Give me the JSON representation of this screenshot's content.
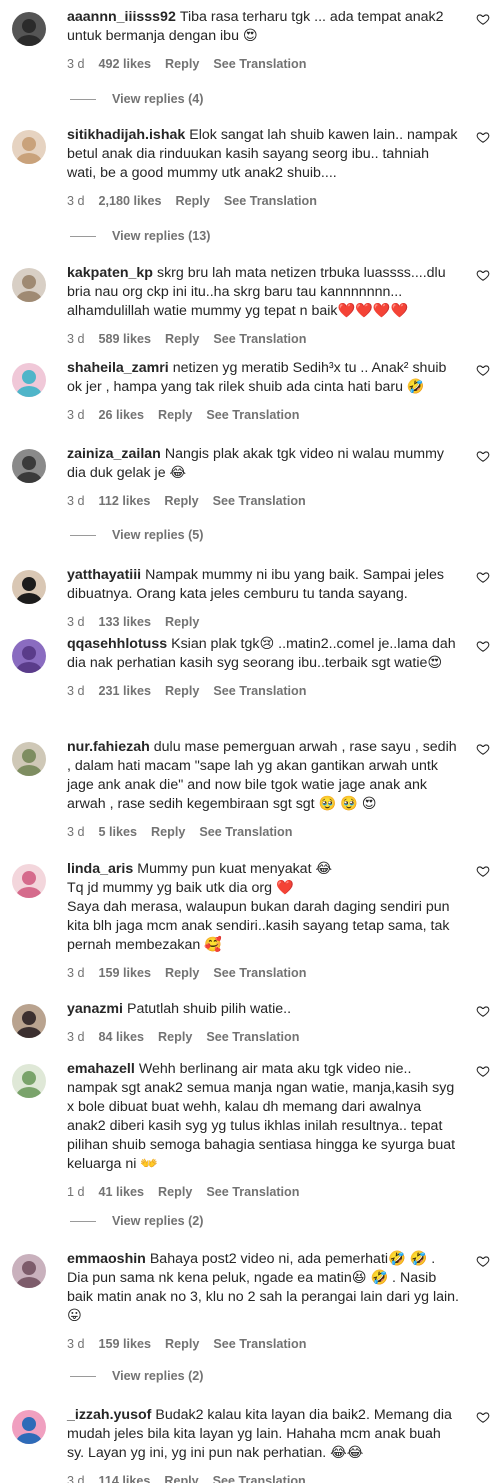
{
  "comments": [
    {
      "username": "aaannn_iiisss92",
      "text": "Tiba rasa terharu tgk ... ada tempat anak2 untuk bermanja dengan ibu 😍",
      "time": "3 d",
      "likes": "492 likes",
      "reply": "Reply",
      "translate": "See Translation",
      "view_replies": "View replies (4)"
    },
    {
      "username": "sitikhadijah.ishak",
      "text": "Elok sangat lah shuib kawen lain.. nampak betul anak dia rinduukan kasih sayang seorg ibu.. tahniah wati, be a good mummy utk anak2 shuib....",
      "time": "3 d",
      "likes": "2,180 likes",
      "reply": "Reply",
      "translate": "See Translation",
      "view_replies": "View replies (13)"
    },
    {
      "username": "kakpaten_kp",
      "text": "skrg bru lah mata netizen trbuka luassss....dlu bria nau org ckp ini itu..ha skrg baru tau kannnnnnn... alhamdulillah watie mummy yg tepat n baik❤️❤️❤️❤️",
      "time": "3 d",
      "likes": "589 likes",
      "reply": "Reply",
      "translate": "See Translation",
      "view_replies": ""
    },
    {
      "username": "shaheila_zamri",
      "text": "netizen yg meratib Sedih³x tu .. Anak² shuib ok jer , hampa yang tak rilek shuib ada cinta hati baru 🤣",
      "time": "3 d",
      "likes": "26 likes",
      "reply": "Reply",
      "translate": "See Translation",
      "view_replies": ""
    },
    {
      "username": "zainiza_zailan",
      "text": "Nangis plak akak tgk video ni walau mummy dia duk gelak je 😂",
      "time": "3 d",
      "likes": "112 likes",
      "reply": "Reply",
      "translate": "See Translation",
      "view_replies": "View replies (5)"
    },
    {
      "username": "yatthayatiii",
      "text": "Nampak mummy ni ibu yang baik. Sampai jeles dibuatnya. Orang kata jeles cemburu tu tanda sayang.",
      "time": "3 d",
      "likes": "133 likes",
      "reply": "Reply",
      "translate": "",
      "view_replies": ""
    },
    {
      "username": "qqasehhlotuss",
      "text": "Ksian plak tgk😢 ..matin2..comel je..lama dah dia nak perhatian kasih syg seorang ibu..terbaik sgt watie😍",
      "time": "3 d",
      "likes": "231 likes",
      "reply": "Reply",
      "translate": "See Translation",
      "view_replies": ""
    },
    {
      "username": "nur.fahiezah",
      "text": "dulu mase pemerguan arwah , rase sayu , sedih , dalam hati macam \"sape lah yg akan gantikan arwah untk jage ank anak die\" and now bile tgok watie jage anak ank arwah , rase sedih kegembiraan sgt sgt 🥹 🥹 😍",
      "time": "3 d",
      "likes": "5 likes",
      "reply": "Reply",
      "translate": "See Translation",
      "view_replies": ""
    },
    {
      "username": "linda_aris",
      "text": "Mummy pun kuat menyakat 😂\nTq jd mummy yg baik utk dia org ❤️\nSaya dah merasa, walaupun bukan darah daging sendiri pun kita blh jaga mcm anak sendiri..kasih sayang tetap sama, tak pernah membezakan 🥰",
      "time": "3 d",
      "likes": "159 likes",
      "reply": "Reply",
      "translate": "See Translation",
      "view_replies": ""
    },
    {
      "username": "yanazmi",
      "text": "Patutlah shuib pilih watie..",
      "time": "3 d",
      "likes": "84 likes",
      "reply": "Reply",
      "translate": "See Translation",
      "view_replies": ""
    },
    {
      "username": "emahazell",
      "text": "Wehh berlinang air mata aku tgk video nie.. nampak sgt anak2 semua manja ngan watie, manja,kasih syg x bole dibuat buat wehh, kalau dh memang dari awalnya anak2 diberi kasih syg yg tulus ikhlas inilah resultnya.. tepat pilihan shuib semoga bahagia sentiasa hingga ke syurga buat keluarga ni 👐",
      "time": "1 d",
      "likes": "41 likes",
      "reply": "Reply",
      "translate": "See Translation",
      "view_replies": "View replies (2)"
    },
    {
      "username": "emmaoshin",
      "text": "Bahaya post2 video ni, ada pemerhati🤣 🤣 . Dia pun sama nk kena peluk, ngade ea matin😆 🤣 . Nasib baik matin anak no 3, klu no 2 sah la perangai lain dari yg lain. 😛",
      "time": "3 d",
      "likes": "159 likes",
      "reply": "Reply",
      "translate": "See Translation",
      "view_replies": "View replies (2)"
    },
    {
      "username": "_izzah.yusof",
      "text": "Budak2 kalau kita layan dia baik2. Memang dia mudah jeles bila kita layan yg lain. Hahaha mcm anak buah sy. Layan yg ini, yg ini pun nak perhatian. 😂😂",
      "time": "3 d",
      "likes": "114 likes",
      "reply": "Reply",
      "translate": "See Translation",
      "view_replies": ""
    }
  ],
  "colors": {
    "text": "#262626",
    "meta": "#737373"
  }
}
